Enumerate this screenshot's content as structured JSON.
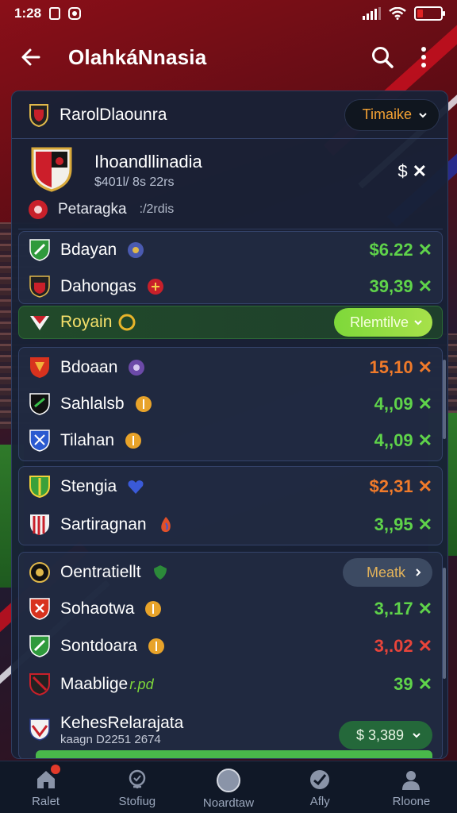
{
  "status_bar": {
    "time": "1:28"
  },
  "app_bar": {
    "title": "OlahkáNnasia"
  },
  "header_row": {
    "team": "RarolDlaounra",
    "dropdown": "Timaike"
  },
  "match": {
    "title": "Ihoandllinadia",
    "subtitle": "$401l/ 8s 22rs",
    "value": "$",
    "minor_label": "Petaragka",
    "minor_sub": ":/2rdis"
  },
  "group1": [
    {
      "name": "Bdayan",
      "odds": "$6.22",
      "color": "green"
    },
    {
      "name": "Dahongas",
      "odds": "39,39",
      "color": "green"
    }
  ],
  "highlight": {
    "name": "Royain",
    "button": "Rlemtilve"
  },
  "group2": [
    {
      "name": "Bdoaan",
      "odds": "15,10",
      "color": "orange"
    },
    {
      "name": "Sahlalsb",
      "odds": "4,,09",
      "color": "green"
    },
    {
      "name": "Tilahan",
      "odds": "4,,09",
      "color": "green"
    }
  ],
  "group3": [
    {
      "name": "Stengia",
      "odds": "$2,31",
      "color": "orange"
    },
    {
      "name": "Sartiragnan",
      "odds": "3,,95",
      "color": "green"
    }
  ],
  "group4": {
    "header_name": "Oentratiellt",
    "header_button": "Meatk",
    "rows": [
      {
        "name": "Sohaotwa",
        "odds": "3,.17",
        "color": "green"
      },
      {
        "name": "Sontdoara",
        "odds": "3,.02",
        "color": "red"
      },
      {
        "name": "Maablige",
        "extra": "r.pd",
        "odds": "39",
        "color": "green"
      }
    ],
    "footer_name": "KehesRelarajata",
    "footer_sub": "kaagn D2251 2674",
    "footer_button": "$ 3,389"
  },
  "bottom_nav": [
    {
      "label": "Ralet",
      "icon": "home-icon"
    },
    {
      "label": "Stofiug",
      "icon": "stats-icon"
    },
    {
      "label": "Noardtaw",
      "icon": "ball-icon"
    },
    {
      "label": "Afly",
      "icon": "activity-icon"
    },
    {
      "label": "Rloone",
      "icon": "profile-icon"
    }
  ],
  "colors": {
    "green": "#5fd34a",
    "orange": "#f07a2a",
    "red": "#e8443a",
    "panel": "#182136"
  }
}
